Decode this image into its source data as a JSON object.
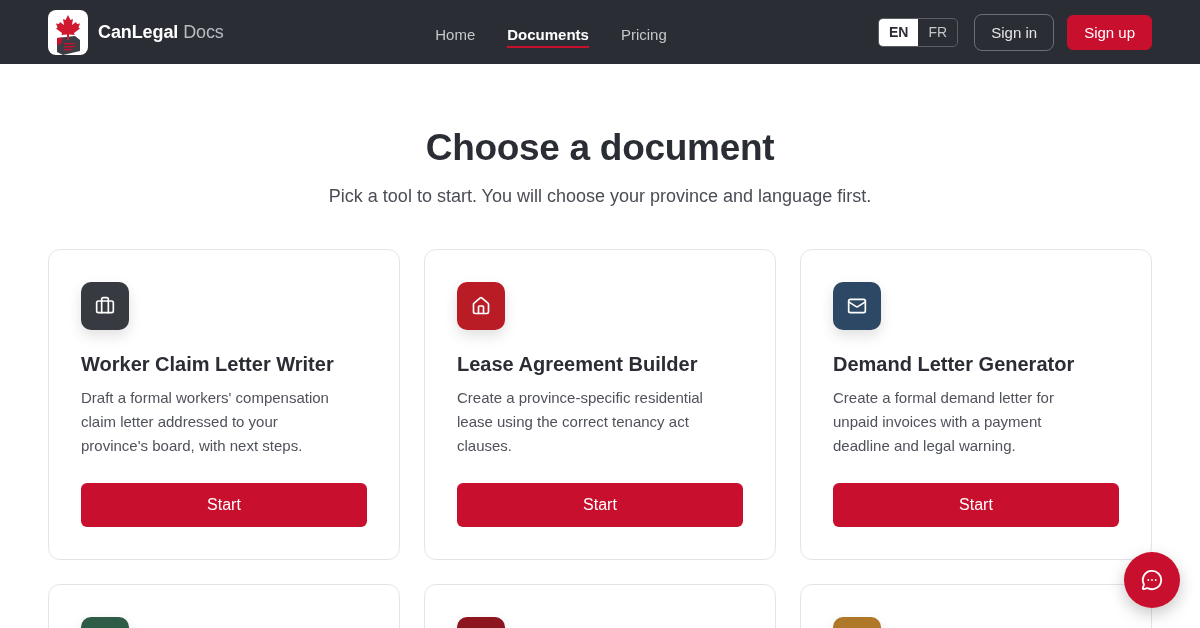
{
  "header": {
    "brand": {
      "name": "CanLegal",
      "suffix": "Docs"
    },
    "nav": [
      {
        "label": "Home",
        "selected": false
      },
      {
        "label": "Documents",
        "selected": true
      },
      {
        "label": "Pricing",
        "selected": false
      }
    ],
    "languages": [
      {
        "label": "EN",
        "selected": true
      },
      {
        "label": "FR",
        "selected": false
      }
    ],
    "buttons": [
      {
        "label": "Sign in",
        "kind": "outline"
      },
      {
        "label": "Sign up",
        "kind": "primary"
      }
    ]
  },
  "hero": {
    "title": "Choose a document",
    "subtitle": "Pick a tool to start. You will choose your province and language first."
  },
  "cards": [
    {
      "color": "#373a41",
      "title": "Worker Claim Letter Writer",
      "description": "Draft a formal workers' compensation claim letter addressed to your province's board, with next steps.",
      "button": "Start"
    },
    {
      "color": "#b91c24",
      "title": "Lease Agreement Builder",
      "description": "Create a province-specific residential lease using the correct tenancy act clauses.",
      "button": "Start"
    },
    {
      "color": "#2d4864",
      "title": "Demand Letter Generator",
      "description": "Create a formal demand letter for unpaid invoices with a payment deadline and legal warning.",
      "button": "Start"
    },
    {
      "color": "#2e5c46"
    },
    {
      "color": "#8c1520"
    },
    {
      "color": "#ae7828"
    }
  ]
}
